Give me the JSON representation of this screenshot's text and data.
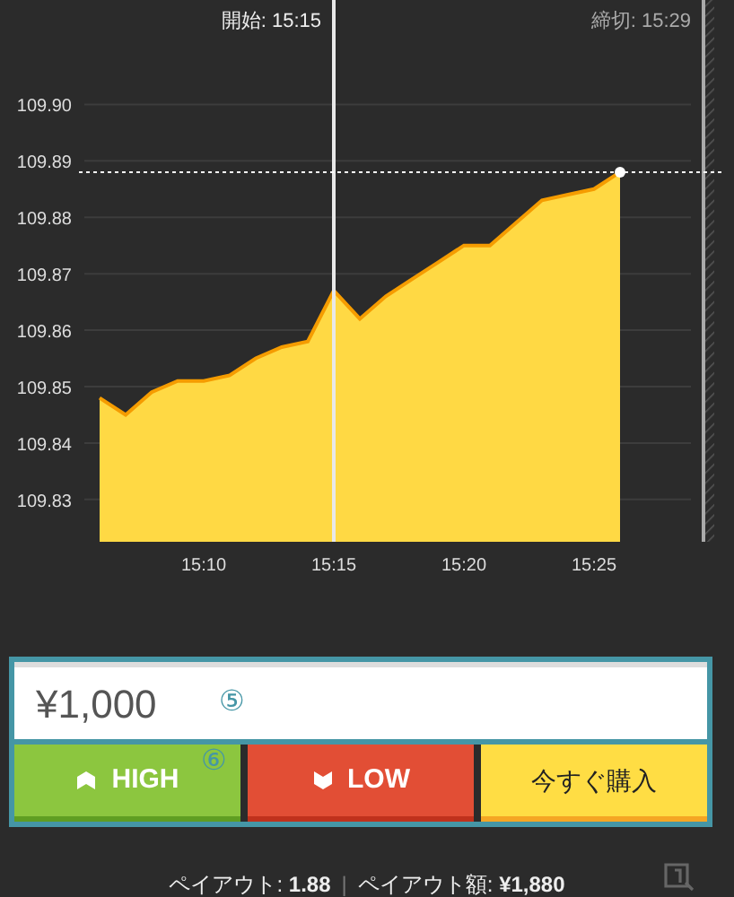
{
  "chart": {
    "start_label": "開始: 15:15",
    "end_label": "締切: 15:29",
    "chart_data": {
      "type": "area",
      "categories": [
        null,
        null,
        null,
        null,
        "15:10",
        null,
        null,
        null,
        null,
        "15:15",
        null,
        null,
        null,
        null,
        "15:20",
        null,
        null,
        null,
        null,
        "15:25",
        null,
        null,
        null,
        null
      ],
      "series": [
        {
          "color": "#ffd944",
          "values": [
            109.848,
            109.845,
            109.849,
            109.851,
            109.851,
            109.852,
            109.855,
            109.857,
            109.858,
            109.867,
            109.862,
            109.866,
            109.869,
            109.872,
            109.875,
            109.875,
            109.879,
            109.883,
            109.884,
            109.885,
            109.888,
            null,
            null,
            null
          ]
        }
      ],
      "ylim": [
        109.8225,
        109.9185
      ],
      "grid": true,
      "ref_lines": [
        {
          "axis": "y",
          "value": 109.888
        }
      ],
      "yticks": [
        {
          "value": 109.83,
          "label": "109.83"
        },
        {
          "value": 109.84,
          "label": "109.84"
        },
        {
          "value": 109.85,
          "label": "109.85"
        },
        {
          "value": 109.86,
          "label": "109.86"
        },
        {
          "value": 109.87,
          "label": "109.87"
        },
        {
          "value": 109.88,
          "label": "109.88"
        },
        {
          "value": 109.89,
          "label": "109.89"
        },
        {
          "value": 109.9,
          "label": "109.90"
        }
      ]
    }
  },
  "amount_field": {
    "value": "¥1,000",
    "marker": "⑤"
  },
  "buttons": [
    {
      "kind": "high",
      "label": "HIGH",
      "marker": "⑥"
    },
    {
      "kind": "low",
      "label": "LOW"
    },
    {
      "kind": "buy",
      "label": "今すぐ購入"
    }
  ],
  "payout": {
    "rate": "ペイアウト: **1.88**",
    "separator": "|",
    "amount": "ペイアウト額: **¥1,880**"
  }
}
